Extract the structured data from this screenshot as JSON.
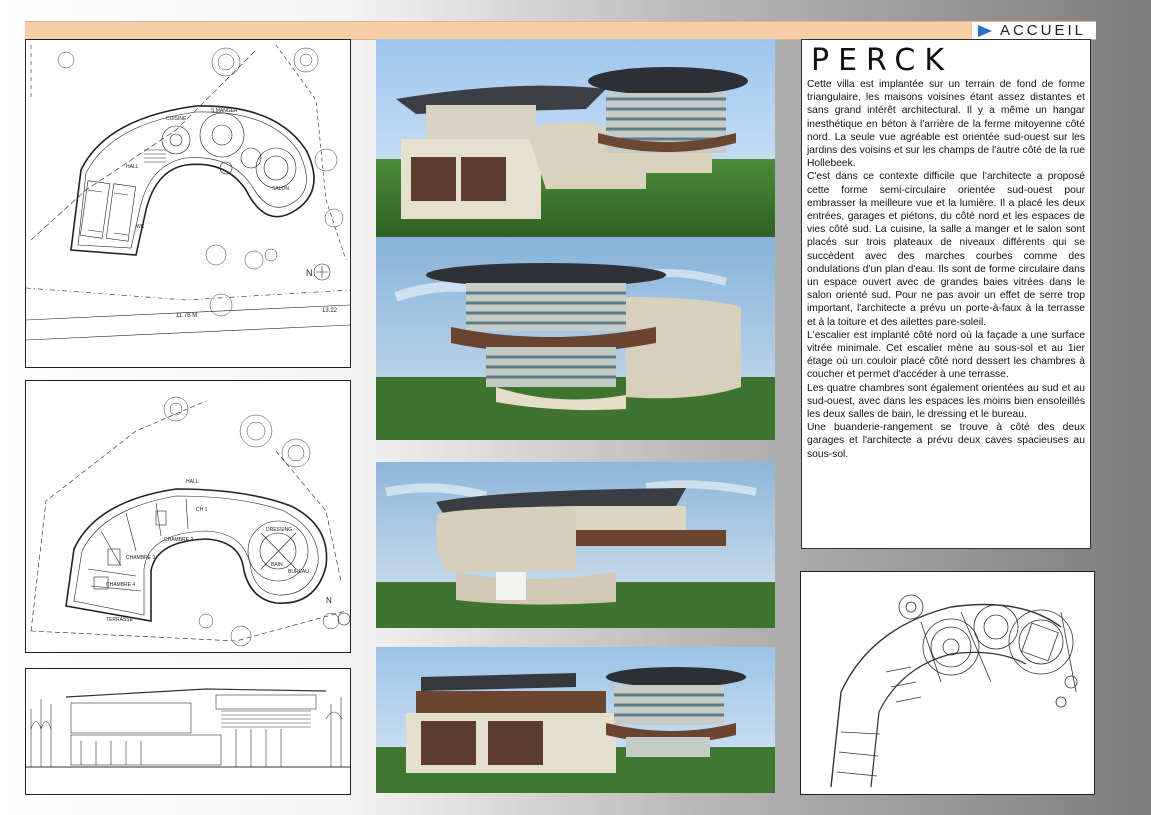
{
  "header": {
    "nav_label": "ACCUEIL",
    "nav_icon": "triangle-arrow-icon",
    "band_color": "#f7cfa6",
    "accent_color": "#2b6fc9"
  },
  "article": {
    "title": "PERCK",
    "body": "Cette villa est implantée sur un terrain de fond de forme triangulaire, les maisons voisines étant assez distantes et sans grand intérêt architectural. Il y a même un hangar inesthétique en béton à l'arrière de la  ferme mitoyenne côté nord. La seule vue agréable est orientée sud-ouest sur les jardins des voisins et sur les champs de l'autre côté de la rue Hollebeek.\nC'est dans ce contexte difficile que l'architecte a proposé cette forme semi-circulaire orientée sud-ouest pour embrasser la meilleure vue et la lumière. Il a placé les deux entrées, garages et piétons, du côté nord et les espaces de vies côté sud. La cuisine, la salle a manger et le salon sont placés sur trois plateaux de niveaux différents qui se succèdent avec des marches courbes comme des ondulations d'un plan d'eau. Ils sont de forme circulaire dans un espace ouvert avec de grandes baies vitrées dans le salon orienté sud. Pour ne pas avoir un effet de serre trop important, l'architecte a prévu un porte-à-faux à la terrasse et à la  toiture et des ailettes pare-soleil.\nL'escalier est implanté côté nord où la façade a une surface vitrée minimale. Cet escalier mène au sous-sol et au 1ier étage où un couloir placé côté nord dessert les chambres à coucher et permet d'accéder à une terrasse.\nLes quatre chambres sont également orientées au sud et au sud-ouest, avec dans les espaces les moins bien ensoleillés les deux salles de bain, le dressing et le bureau.\nUne buanderie-rangement se trouve à côté des deux garages et l'architecte a prévu deux caves spacieuses au sous-sol."
  },
  "plans": {
    "ground_floor": {
      "rooms": [
        "HALL",
        "CUISINE",
        "S.MANGER",
        "SALON",
        "WC"
      ],
      "dims": [
        "11.76 M",
        "13.22"
      ],
      "north": "N"
    },
    "first_floor": {
      "rooms": [
        "HALL",
        "CH 1",
        "CHAMBRE 2",
        "CHAMBRE 3",
        "CHAMBRE 4",
        "DRESSING",
        "BAIN",
        "BUREAU",
        "TERRASSE"
      ],
      "north": "N"
    }
  }
}
